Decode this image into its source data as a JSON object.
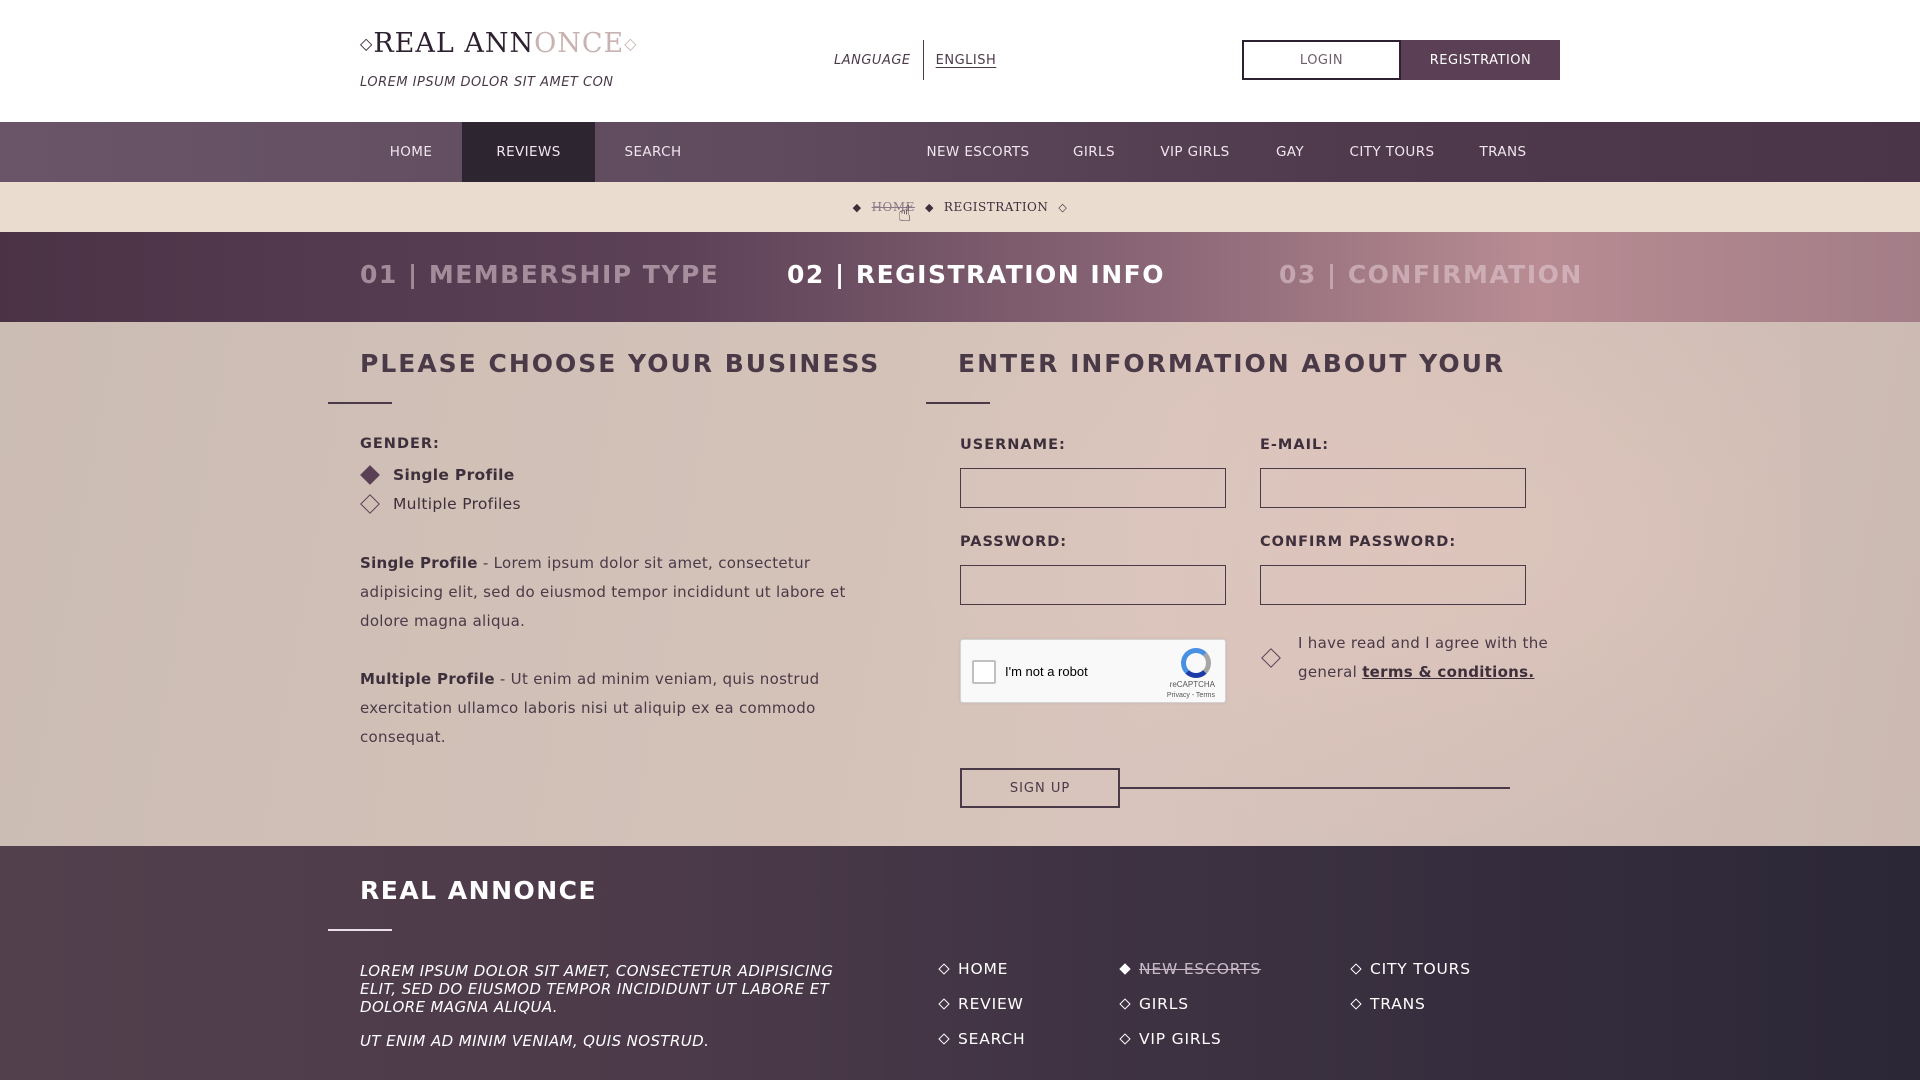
{
  "header": {
    "logo_main": "REAL ANN",
    "logo_fade": "ONCE",
    "tagline": "LOREM IPSUM DOLOR SIT AMET CON",
    "language_label": "LANGUAGE",
    "language_value": "ENGLISH",
    "login_label": "LOGIN",
    "registration_label": "REGISTRATION"
  },
  "nav": {
    "items": [
      "HOME",
      "REVIEWS",
      "SEARCH",
      "NEW ESCORTS",
      "GIRLS",
      "VIP GIRLS",
      "GAY",
      "CITY TOURS",
      "TRANS"
    ],
    "active": "REVIEWS"
  },
  "breadcrumb": {
    "home": "HOME",
    "current": "REGISTRATION"
  },
  "steps": {
    "step1": "01 | MEMBERSHIP TYPE",
    "step2": "02 | REGISTRATION INFO",
    "step3": "03 | CONFIRMATION",
    "active": 2
  },
  "left": {
    "title": "PLEASE CHOOSE YOUR BUSINESS",
    "gender_label": "GENDER:",
    "option_single": "Single Profile",
    "option_multiple": "Multiple Profiles",
    "selected": "Single Profile",
    "single_term": "Single Profile",
    "single_desc": " - Lorem ipsum dolor sit amet, consectetur adipisicing elit, sed do eiusmod tempor incididunt ut labore et dolore magna aliqua.",
    "multiple_term": "Multiple Profile",
    "multiple_desc": " - Ut enim ad minim veniam, quis nostrud exercitation ullamco laboris nisi ut aliquip ex ea commodo consequat."
  },
  "right": {
    "title": "ENTER INFORMATION ABOUT YOUR",
    "username_label": "USERNAME:",
    "email_label": "E-MAIL:",
    "password_label": "PASSWORD:",
    "confirm_label": "CONFIRM PASSWORD:",
    "captcha_text": "I'm not a robot",
    "captcha_brand": "reCAPTCHA",
    "captcha_terms": "Privacy - Terms",
    "agree_text": "I have read and I agree with the general ",
    "agree_link": "terms & conditions.",
    "signup_label": "SIGN UP"
  },
  "footer": {
    "title": "REAL ANNONCE",
    "text1": "LOREM IPSUM DOLOR SIT AMET, CONSECTETUR ADIPISICING ELIT, SED DO EIUSMOD TEMPOR INCIDIDUNT UT LABORE ET DOLORE MAGNA ALIQUA.",
    "text2": "UT ENIM AD MINIM VENIAM, QUIS NOSTRUD.",
    "links": {
      "home": "HOME",
      "review": "REVIEW",
      "search": "SEARCH",
      "new_escorts": "NEW ESCORTS",
      "girls": "GIRLS",
      "vip_girls": "VIP GIRLS",
      "city_tours": "CITY TOURS",
      "trans": "TRANS"
    }
  },
  "colors": {
    "accent": "#5a3f55",
    "nav_active": "#2d2630",
    "breadcrumb_bg": "#ebdcd0"
  }
}
